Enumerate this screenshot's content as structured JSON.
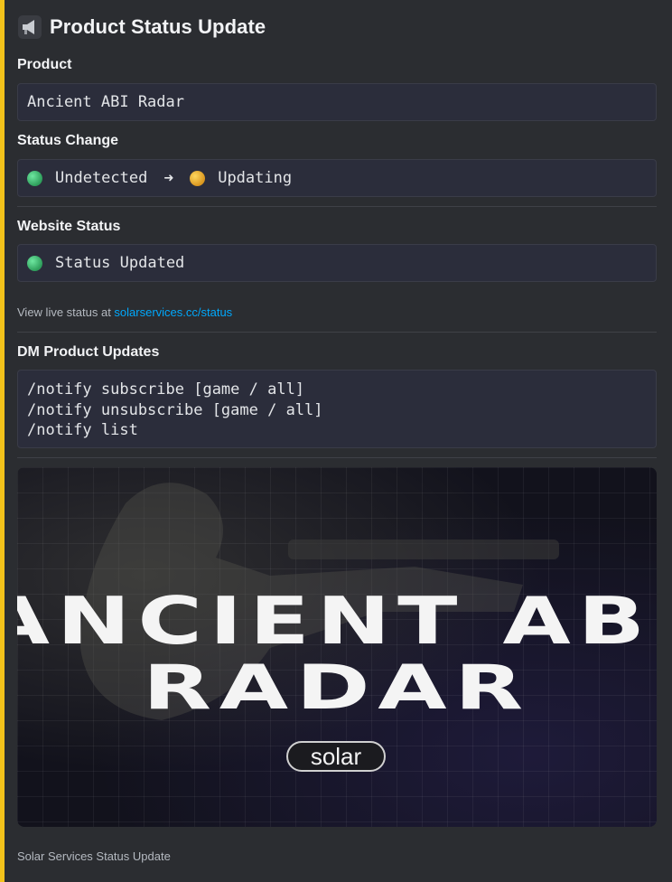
{
  "header": {
    "title": "Product Status Update",
    "icon": "megaphone-icon"
  },
  "fields": {
    "product": {
      "label": "Product",
      "value": "Ancient ABI Radar"
    },
    "status_change": {
      "label": "Status Change",
      "from": "Undetected",
      "arrow": "➜",
      "to": "Updating"
    },
    "website_status": {
      "label": "Website Status",
      "value": "Status Updated"
    },
    "live": {
      "prefix": "View live status at ",
      "link_text": "solarservices.cc/status"
    },
    "dm": {
      "label": "DM Product Updates",
      "commands": [
        "/notify subscribe [game / all]",
        "/notify unsubscribe [game / all]",
        "/notify list"
      ]
    }
  },
  "banner": {
    "line1": "ANCIENT ABI",
    "line2": "RADAR",
    "badge": "solar"
  },
  "footer": {
    "text": "Solar Services Status Update"
  },
  "colors": {
    "accent_bar": "#f2c21b",
    "link": "#00a8fc",
    "green": "#3fbf7a",
    "yellow": "#f0b232",
    "background": "#2b2d31"
  }
}
